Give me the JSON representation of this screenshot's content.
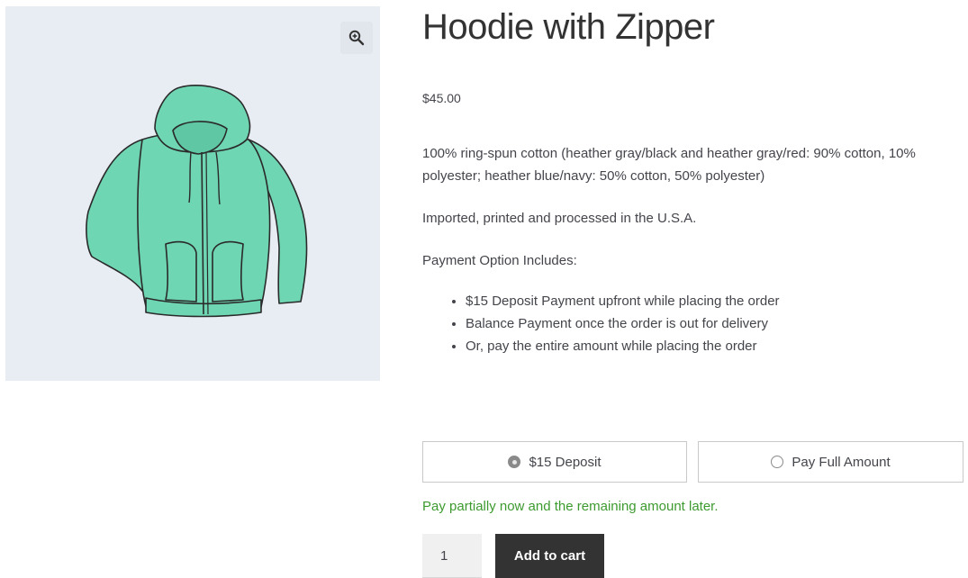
{
  "product": {
    "title": "Hoodie with Zipper",
    "price": "$45.00",
    "description": {
      "paragraphs": [
        "100% ring-spun cotton (heather gray/black and heather gray/red: 90% cotton, 10% polyester; heather blue/navy: 50% cotton, 50% polyester)",
        "Imported, printed and processed in the U.S.A.",
        "Payment Option Includes:"
      ],
      "bullets": [
        "$15 Deposit Payment upfront while placing the order",
        "Balance Payment once the order is out for delivery",
        "Or, pay the entire amount while placing the order"
      ]
    }
  },
  "gallery": {
    "zoom_icon": "magnifier-plus-icon",
    "image": "hoodie-with-zipper"
  },
  "payment_options": {
    "deposit_label": "$15 Deposit",
    "full_label": "Pay Full Amount",
    "selected": "deposit",
    "note": "Pay partially now and the remaining amount later."
  },
  "cart": {
    "quantity": "1",
    "add_label": "Add to cart"
  },
  "colors": {
    "note_green": "#3d9a2f",
    "button_dark": "#333333",
    "gallery_bg": "#e8edf3",
    "hoodie_fill": "#6fd6b3"
  }
}
